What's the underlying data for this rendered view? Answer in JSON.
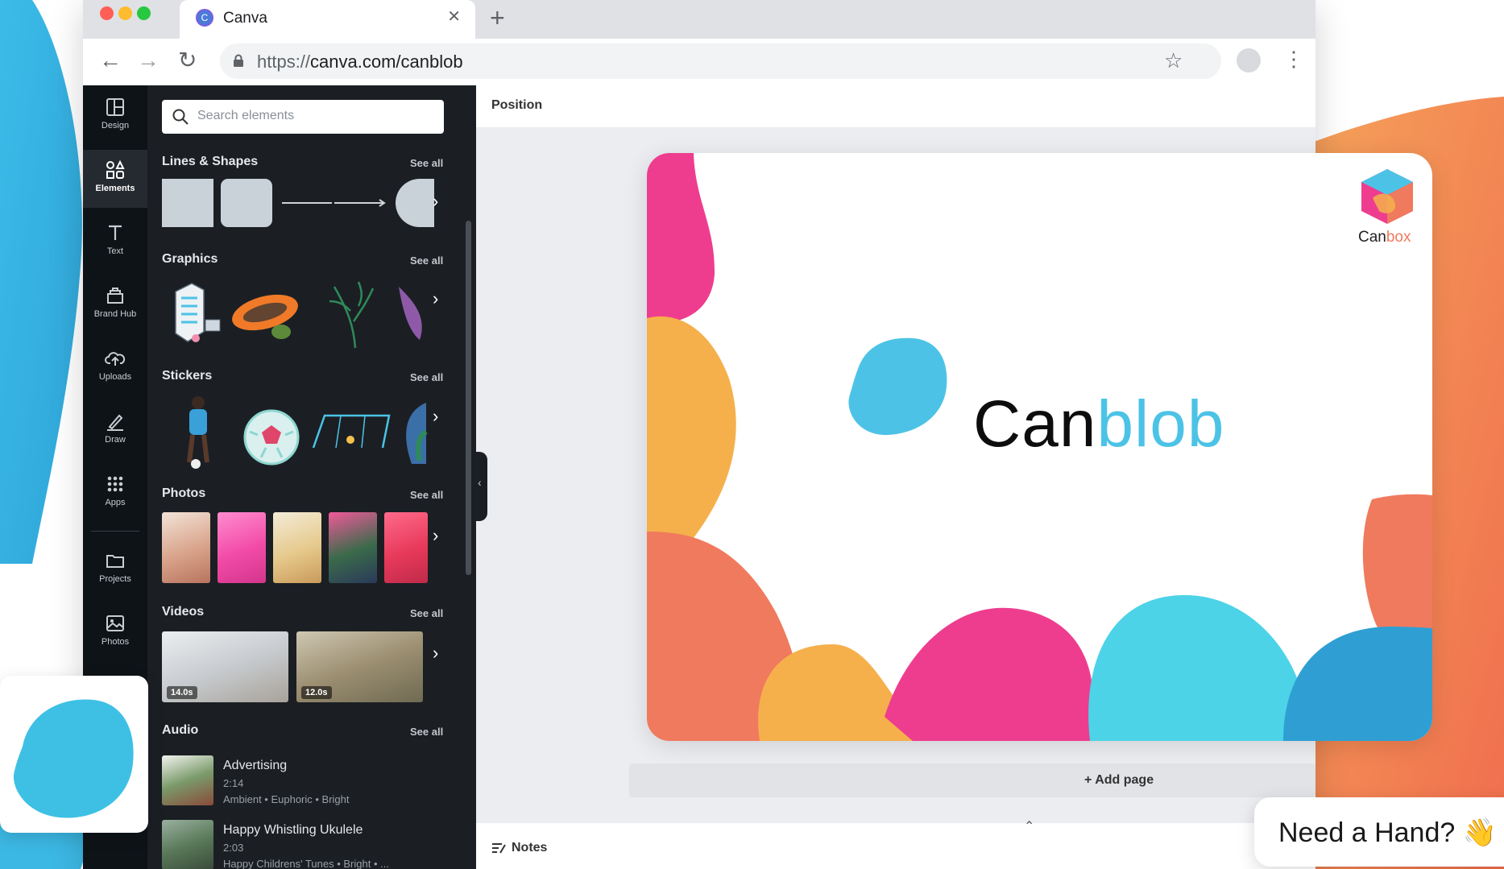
{
  "browser": {
    "tab_title": "Canva",
    "url_scheme": "https://",
    "url_host": "canva.com/canblob"
  },
  "rail": {
    "items": [
      {
        "label": "Design",
        "icon": "layout-icon"
      },
      {
        "label": "Elements",
        "icon": "shapes-icon",
        "active": true
      },
      {
        "label": "Text",
        "icon": "text-icon"
      },
      {
        "label": "Brand Hub",
        "icon": "brand-hub-icon"
      },
      {
        "label": "Uploads",
        "icon": "cloud-upload-icon"
      },
      {
        "label": "Draw",
        "icon": "pen-icon"
      },
      {
        "label": "Apps",
        "icon": "grid-icon"
      },
      {
        "label": "Projects",
        "icon": "folder-icon"
      },
      {
        "label": "Photos",
        "icon": "image-icon"
      }
    ]
  },
  "panel": {
    "search_placeholder": "Search elements",
    "see_all": "See all",
    "sections": {
      "lines": "Lines & Shapes",
      "graphics": "Graphics",
      "stickers": "Stickers",
      "photos": "Photos",
      "videos": "Videos",
      "audio": "Audio"
    },
    "videos": [
      {
        "duration": "14.0s"
      },
      {
        "duration": "12.0s"
      }
    ],
    "audio": [
      {
        "title": "Advertising",
        "duration": "2:14",
        "tags": "Ambient • Euphoric • Bright"
      },
      {
        "title": "Happy Whistling Ukulele",
        "duration": "2:03",
        "tags": "Happy Childrens' Tunes • Bright • ..."
      }
    ]
  },
  "editor": {
    "position_label": "Position",
    "add_page": "+ Add page",
    "notes": "Notes"
  },
  "design": {
    "brand_dark": "Can",
    "brand_light": "blob",
    "logo_dark": "Can",
    "logo_light": "box"
  },
  "help": {
    "text": "Need a Hand? 👋"
  },
  "colors": {
    "cyan": "#4cc3e6",
    "pink": "#ee3d8f",
    "orange": "#f5b04c",
    "coral": "#f07a5d",
    "blue": "#2f9fd3",
    "rail_bg": "#0e1318",
    "panel_bg": "#1b1f24"
  }
}
